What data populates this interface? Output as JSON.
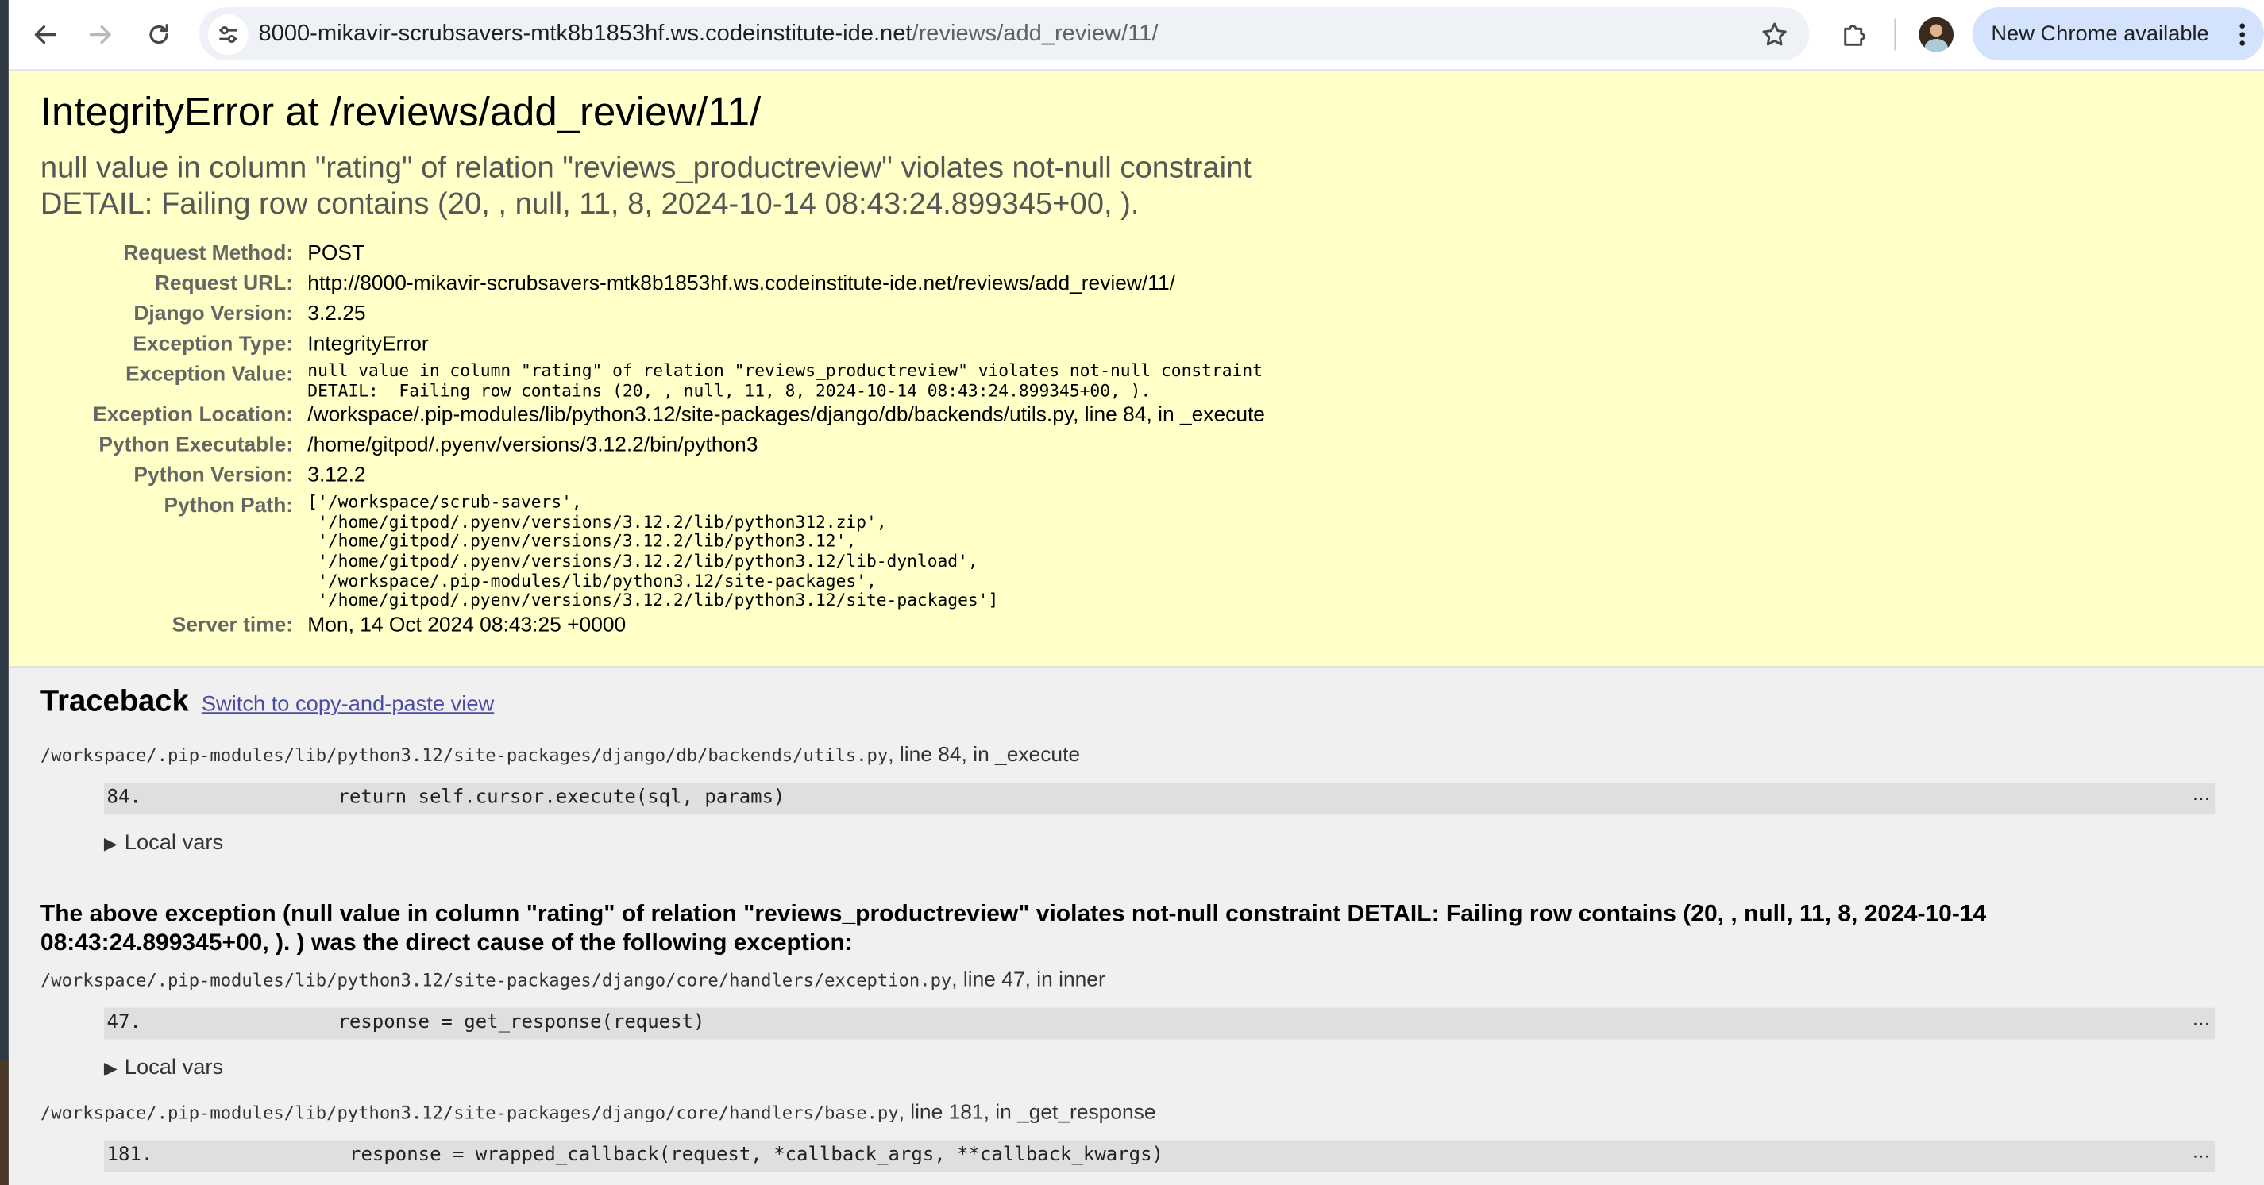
{
  "browser": {
    "url_host": "8000-mikavir-scrubsavers-mtk8b1853hf.ws.codeinstitute-ide.net",
    "url_path": "/reviews/add_review/11/",
    "update_button_label": "New Chrome available",
    "icons": [
      "back-icon",
      "forward-icon",
      "reload-icon",
      "site-info-icon",
      "bookmark-star-icon",
      "extensions-icon",
      "profile-avatar",
      "more-options-icon"
    ]
  },
  "error": {
    "title": "IntegrityError at /reviews/add_review/11/",
    "summary_line1": "null value in column \"rating\" of relation \"reviews_productreview\" violates not-null constraint",
    "summary_line2": "DETAIL:  Failing row contains (20, , null, 11, 8, 2024-10-14 08:43:24.899345+00, ).",
    "meta": [
      {
        "label": "Request Method:",
        "value": "POST"
      },
      {
        "label": "Request URL:",
        "value": "http://8000-mikavir-scrubsavers-mtk8b1853hf.ws.codeinstitute-ide.net/reviews/add_review/11/"
      },
      {
        "label": "Django Version:",
        "value": "3.2.25"
      },
      {
        "label": "Exception Type:",
        "value": "IntegrityError"
      },
      {
        "label": "Exception Value:",
        "value": "null value in column \"rating\" of relation \"reviews_productreview\" violates not-null constraint\nDETAIL:  Failing row contains (20, , null, 11, 8, 2024-10-14 08:43:24.899345+00, )."
      },
      {
        "label": "Exception Location:",
        "value": "/workspace/.pip-modules/lib/python3.12/site-packages/django/db/backends/utils.py, line 84, in _execute"
      },
      {
        "label": "Python Executable:",
        "value": "/home/gitpod/.pyenv/versions/3.12.2/bin/python3"
      },
      {
        "label": "Python Version:",
        "value": "3.12.2"
      },
      {
        "label": "Python Path:",
        "value": "['/workspace/scrub-savers',\n '/home/gitpod/.pyenv/versions/3.12.2/lib/python312.zip',\n '/home/gitpod/.pyenv/versions/3.12.2/lib/python3.12',\n '/home/gitpod/.pyenv/versions/3.12.2/lib/python3.12/lib-dynload',\n '/workspace/.pip-modules/lib/python3.12/site-packages',\n '/home/gitpod/.pyenv/versions/3.12.2/lib/python3.12/site-packages']"
      },
      {
        "label": "Server time:",
        "value": "Mon, 14 Oct 2024 08:43:25 +0000"
      }
    ]
  },
  "traceback": {
    "heading": "Traceback",
    "switch_link": "Switch to copy-and-paste view",
    "local_vars_label": "Local vars",
    "frames": [
      {
        "file": "/workspace/.pip-modules/lib/python3.12/site-packages/django/db/backends/utils.py",
        "suffix": ", line 84, in _execute",
        "lineno": "84.",
        "code": "return self.cursor.execute(sql, params)"
      },
      {
        "file": "/workspace/.pip-modules/lib/python3.12/site-packages/django/core/handlers/exception.py",
        "suffix": ", line 47, in inner",
        "lineno": "47.",
        "code": "response = get_response(request)"
      },
      {
        "file": "/workspace/.pip-modules/lib/python3.12/site-packages/django/core/handlers/base.py",
        "suffix": ", line 181, in _get_response",
        "lineno": "181.",
        "code": "response = wrapped_callback(request, *callback_args, **callback_kwargs)"
      }
    ],
    "ellipsis": "…",
    "cause_text": "The above exception (null value in column \"rating\" of relation \"reviews_productreview\" violates not-null constraint DETAIL: Failing row contains (20, , null, 11, 8, 2024-10-14 08:43:24.899345+00, ). ) was the direct cause of the following exception:"
  }
}
